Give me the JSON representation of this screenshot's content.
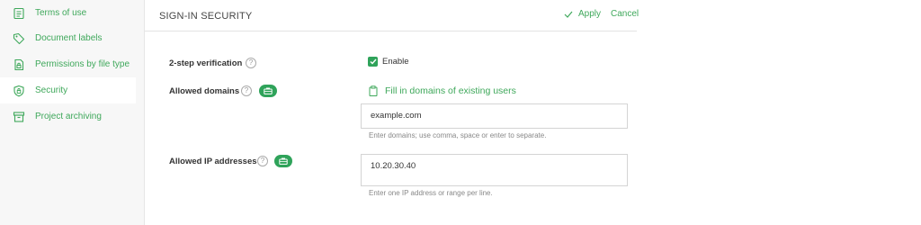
{
  "sidebar": {
    "items": [
      {
        "label": "Terms of use",
        "icon": "document-text-icon"
      },
      {
        "label": "Document labels",
        "icon": "tag-icon"
      },
      {
        "label": "Permissions by file type",
        "icon": "file-lock-icon"
      },
      {
        "label": "Security",
        "icon": "shield-icon",
        "active": true
      },
      {
        "label": "Project archiving",
        "icon": "archive-icon"
      }
    ]
  },
  "header": {
    "title": "SIGN-IN SECURITY",
    "apply_label": "Apply",
    "cancel_label": "Cancel"
  },
  "form": {
    "two_step": {
      "label": "2-step verification",
      "checkbox_label": "Enable",
      "checked": true
    },
    "allowed_domains": {
      "label": "Allowed domains",
      "fill_link": "Fill in domains of existing users",
      "value": "example.com",
      "hint": "Enter domains; use comma, space or enter to separate."
    },
    "allowed_ips": {
      "label": "Allowed IP addresses",
      "value": "10.20.30.40",
      "hint": "Enter one IP address or range per line."
    },
    "help_glyph": "?"
  },
  "colors": {
    "accent": "#3fa85b",
    "badge": "#2fa35a",
    "sidebar_bg": "#f7f7f7"
  }
}
